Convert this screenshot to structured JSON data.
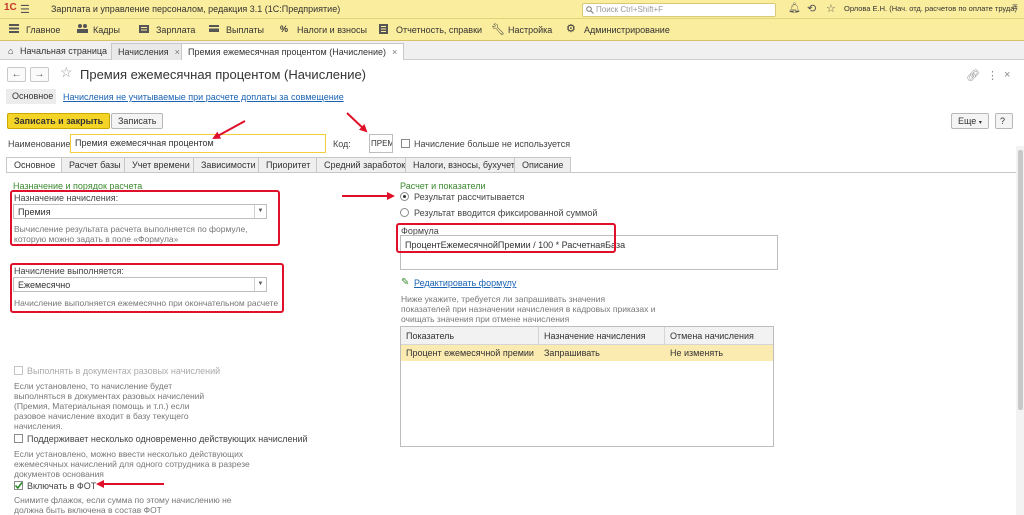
{
  "app": {
    "logo": "1С",
    "title": "Зарплата и управление персоналом, редакция 3.1  (1С:Предприятие)",
    "search_placeholder": "Поиск Ctrl+Shift+F",
    "user": "Орлова Е.Н. (Нач. отд. расчетов по оплате труда)"
  },
  "menu": [
    {
      "label": "Главное",
      "icon": "list-icon"
    },
    {
      "label": "Кадры",
      "icon": "people-icon"
    },
    {
      "label": "Зарплата",
      "icon": "salary-icon"
    },
    {
      "label": "Выплаты",
      "icon": "payments-icon"
    },
    {
      "label": "Налоги и взносы",
      "icon": "percent-icon"
    },
    {
      "label": "Отчетность, справки",
      "icon": "reports-icon"
    },
    {
      "label": "Настройка",
      "icon": "wrench-icon"
    },
    {
      "label": "Администрирование",
      "icon": "gear-icon"
    }
  ],
  "window_tabs": [
    "Начальная страница",
    "Начисления",
    "Премия ежемесячная процентом (Начисление)"
  ],
  "form": {
    "title": "Премия ежемесячная процентом (Начисление)",
    "subnav_main": "Основное",
    "subnav_link": "Начисления не учитываемые при расчете доплаты за совмещение",
    "btn_save_close": "Записать и закрыть",
    "btn_save": "Записать",
    "btn_more": "Еще",
    "name_label": "Наименование:",
    "name_value": "Премия ежемесячная процентом",
    "code_label": "Код:",
    "code_value": "ПРЕМП",
    "unused_label": "Начисление больше не используется"
  },
  "form_tabs": [
    "Основное",
    "Расчет базы",
    "Учет времени",
    "Зависимости",
    "Приоритет",
    "Средний заработок",
    "Налоги, взносы, бухучет",
    "Описание"
  ],
  "left": {
    "section_title": "Назначение и порядок расчета",
    "purpose_label": "Назначение начисления:",
    "purpose_value": "Премия",
    "purpose_hint": [
      "Вычисление результата расчета выполняется по формуле,",
      "которую можно задать в поле «Формула»"
    ],
    "exec_label": "Начисление выполняется:",
    "exec_value": "Ежемесячно",
    "exec_hint": "Начисление выполняется ежемесячно при окончательном расчете",
    "one_time_label": "Выполнять в документах разовых начислений",
    "one_time_hint": [
      "Если установлено, то начисление будет",
      "выполняться в документах разовых начислений",
      "(Премия, Материальная помощь и т.п.) если",
      "разовое начисление входит в базу текущего",
      "начисления."
    ],
    "multi_label": "Поддерживает несколько одновременно действующих начислений",
    "multi_hint": [
      "Если установлено, можно ввести несколько действующих",
      "ежемесячных начислений для одного сотрудника в разрезе",
      "документов основания"
    ],
    "fot_label": "Включать в ФОТ",
    "fot_checked": true,
    "fot_hint": [
      "Снимите флажок, если сумма по этому начислению не",
      "должна быть включена в состав ФОТ"
    ]
  },
  "right": {
    "section_title": "Расчет и показатели",
    "radio_calc": "Результат рассчитывается",
    "radio_fixed": "Результат вводится фиксированной суммой",
    "selected_radio": "calc",
    "formula_label": "Формула",
    "formula_value": "ПроцентЕжемесячнойПремии / 100 * РасчетнаяБаза",
    "edit_formula_link": "Редактировать формулу",
    "indicators_hint": [
      "Ниже укажите, требуется ли запрашивать значения",
      "показателей при назначении начисления в кадровых приказах и",
      "очищать значения при отмене начисления"
    ],
    "table": {
      "headers": [
        "Показатель",
        "Назначение начисления",
        "Отмена начисления"
      ],
      "rows": [
        [
          "Процент ежемесячной премии",
          "Запрашивать",
          "Не изменять"
        ]
      ]
    }
  },
  "colors": {
    "accent": "#f5d428",
    "annotation": "#e0102a",
    "link": "#1a63b3",
    "section": "#3a8a2e"
  }
}
